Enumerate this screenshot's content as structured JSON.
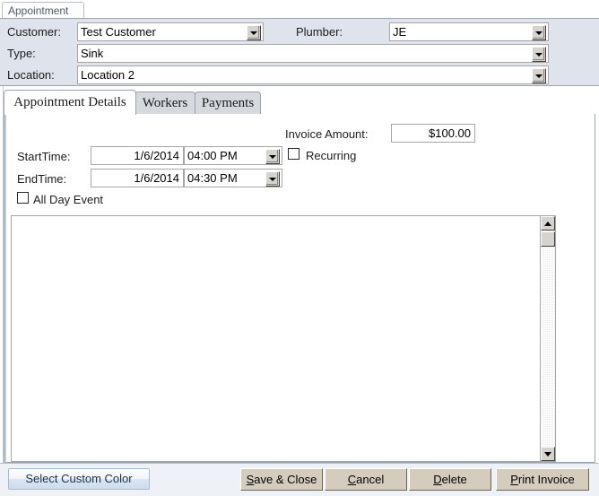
{
  "window": {
    "title": "Appointment"
  },
  "header": {
    "customer": {
      "label": "Customer:",
      "value": "Test Customer",
      "icon": "chevron-down-icon"
    },
    "plumber": {
      "label": "Plumber:",
      "value": "JE",
      "icon": "chevron-down-icon"
    },
    "type": {
      "label": "Type:",
      "value": "Sink",
      "icon": "chevron-down-icon"
    },
    "location": {
      "label": "Location:",
      "value": "Location 2",
      "icon": "chevron-down-icon"
    }
  },
  "tabs": [
    {
      "label": "Appointment Details",
      "active": true
    },
    {
      "label": "Workers",
      "active": false
    },
    {
      "label": "Payments",
      "active": false
    }
  ],
  "details": {
    "invoice_amount": {
      "label": "Invoice Amount:",
      "value": "$100.00"
    },
    "start_time": {
      "label": "StartTime:",
      "date": "1/6/2014",
      "time": "04:00 PM",
      "icon": "chevron-down-icon"
    },
    "end_time": {
      "label": "EndTime:",
      "date": "1/6/2014",
      "time": "04:30 PM",
      "icon": "chevron-down-icon"
    },
    "recurring": {
      "label": "Recurring",
      "checked": false
    },
    "all_day_event": {
      "label": "All Day Event",
      "checked": false
    },
    "notes": {
      "value": "",
      "scrollbar": {
        "up_icon": "triangle-up-icon",
        "down_icon": "triangle-down-icon"
      }
    }
  },
  "footer": {
    "select_custom_color": "Select Custom Color",
    "save_close_accel": "S",
    "save_close_rest": "ave & Close",
    "cancel_accel": "C",
    "cancel_rest": "ancel",
    "delete_accel": "D",
    "delete_rest": "elete",
    "print_invoice_accel": "P",
    "print_invoice_rest": "rint Invoice"
  },
  "colors": {
    "header_bg": "#dfe4ec",
    "footer_bg": "#eef1f5",
    "button_face": "#d4ccbc",
    "panel_border": "#9aa3b0",
    "tab_inactive": "#d6d9de"
  }
}
